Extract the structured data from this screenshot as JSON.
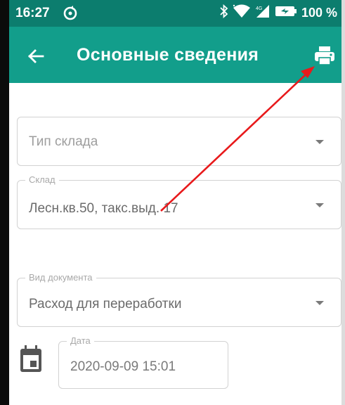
{
  "status_bar": {
    "time": "16:27",
    "battery": "100 %"
  },
  "app_bar": {
    "title": "Основные сведения"
  },
  "form": {
    "warehouse_type": {
      "placeholder": "Тип склада"
    },
    "warehouse": {
      "label": "Склад",
      "value": "Лесн.кв.50, такс.выд. 17"
    },
    "document_type": {
      "label": "Вид документа",
      "value": "Расход для переработки"
    },
    "date": {
      "label": "Дата",
      "value": "2020-09-09 15:01"
    }
  },
  "colors": {
    "status_bar": "#0c7d6e",
    "app_bar": "#129e8b",
    "annotation_arrow": "#e8191b"
  },
  "icons": [
    "sync-icon",
    "bluetooth-icon",
    "wifi-icon",
    "signal-icon",
    "battery-icon",
    "back-arrow-icon",
    "print-icon",
    "dropdown-arrow-icon",
    "calendar-icon"
  ]
}
